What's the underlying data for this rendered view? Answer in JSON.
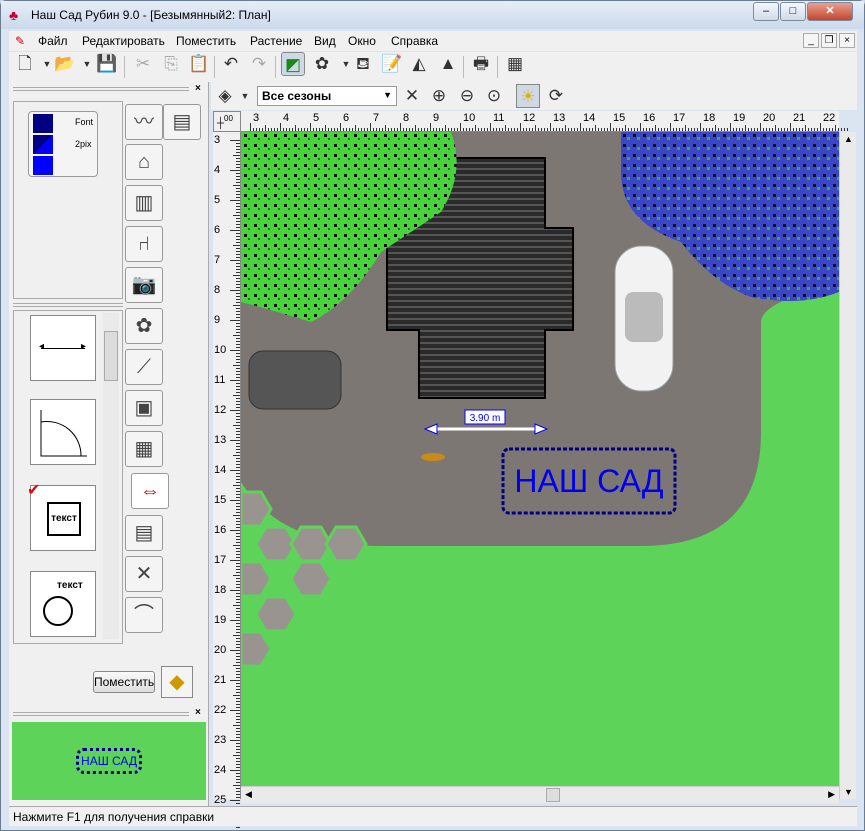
{
  "window": {
    "title": "Наш Сад Рубин 9.0 - [Безымянный2: План]"
  },
  "menu": [
    "Файл",
    "Редактировать",
    "Поместить",
    "Растение",
    "Вид",
    "Окно",
    "Справка"
  ],
  "toolbar": {
    "icons": [
      "new-icon",
      "open-icon",
      "save-icon",
      "cut-icon",
      "copy-icon",
      "paste-icon",
      "undo-icon",
      "redo-icon",
      "draw-plan-icon",
      "plant-icon",
      "watering-can-icon",
      "notes-icon",
      "terrain-icon",
      "cone-icon",
      "print-icon",
      "calculator-icon"
    ]
  },
  "toolbar2": {
    "season": "Все сезоны",
    "icons": [
      "layers-icon",
      "tools-icon",
      "zoom-in-icon",
      "zoom-out-icon",
      "zoom-fit-icon",
      "sun-icon",
      "rotate-icon"
    ]
  },
  "style_panel": {
    "font_label": "Font",
    "width_label": "2pix",
    "colors": [
      "#000080",
      "#0000ff"
    ]
  },
  "tabs": [
    "path",
    "wall",
    "house",
    "fence",
    "bench",
    "camera",
    "flower",
    "log",
    "frame",
    "gradient",
    "dimension",
    "document",
    "tools",
    "stairs"
  ],
  "cards": [
    {
      "name": "linear-dimension"
    },
    {
      "name": "angle-dimension"
    },
    {
      "name": "text-box",
      "label": "текст"
    },
    {
      "name": "text-circle",
      "label": "текст"
    }
  ],
  "place_button": "Поместить",
  "preview": {
    "text": "НАШ САД",
    "bg": "#5ed35a"
  },
  "rulers": {
    "origin": "00",
    "top": [
      3,
      4,
      5,
      6,
      7,
      8,
      9,
      10,
      11,
      12,
      13,
      14,
      15,
      16,
      17,
      18,
      19,
      20,
      21,
      22
    ],
    "left": [
      3,
      4,
      5,
      6,
      7,
      8,
      9,
      10,
      11,
      12,
      13,
      14,
      15,
      16,
      17,
      18,
      19,
      20,
      21,
      22,
      23,
      24,
      25
    ]
  },
  "plan": {
    "dimension_label": "3.90 m",
    "sign_text": "НАШ САД",
    "lawn_color": "#5ed35a",
    "paving_color": "#7d7773",
    "text_color": "#0000ee"
  },
  "status": "Нажмите F1 для получения справки"
}
